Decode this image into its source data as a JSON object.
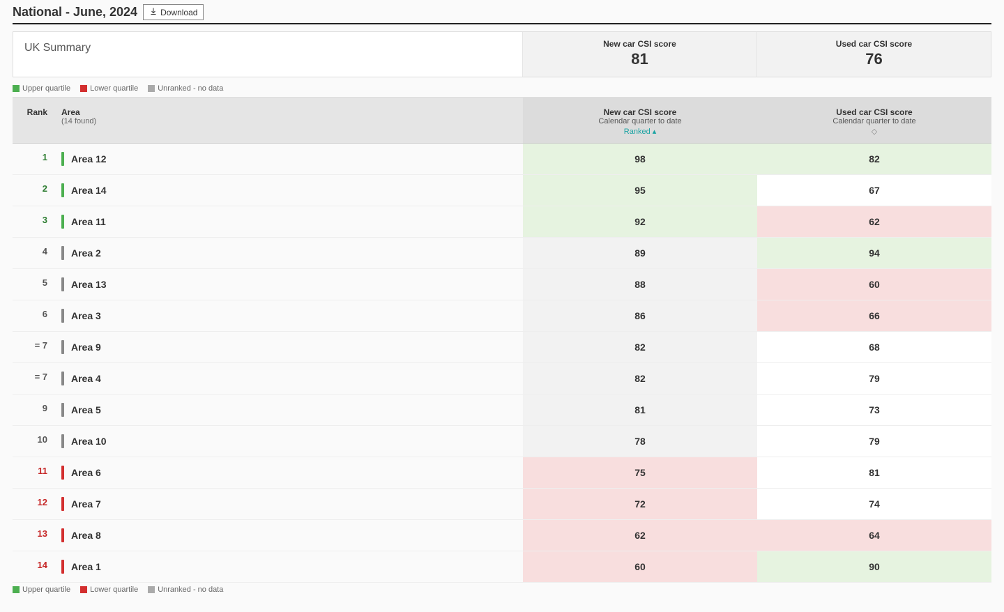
{
  "header": {
    "title": "National - June, 2024",
    "download_label": "Download"
  },
  "summary": {
    "label": "UK Summary",
    "new_title": "New car CSI score",
    "new_value": "81",
    "used_title": "Used car CSI score",
    "used_value": "76"
  },
  "legend": {
    "upper": "Upper quartile",
    "lower": "Lower quartile",
    "unranked": "Unranked - no data"
  },
  "table": {
    "columns": {
      "rank": "Rank",
      "area": "Area",
      "area_sub": "(14 found)",
      "new_title": "New car CSI score",
      "new_sub": "Calendar quarter to date",
      "new_sort": "Ranked",
      "used_title": "Used car CSI score",
      "used_sub": "Calendar quarter to date"
    },
    "rows": [
      {
        "rank": "1",
        "rank_q": "upper",
        "area": "Area 12",
        "new": "98",
        "new_q": "upper",
        "used": "82",
        "used_q": "upper"
      },
      {
        "rank": "2",
        "rank_q": "upper",
        "area": "Area 14",
        "new": "95",
        "new_q": "upper",
        "used": "67",
        "used_q": "white"
      },
      {
        "rank": "3",
        "rank_q": "upper",
        "area": "Area 11",
        "new": "92",
        "new_q": "upper",
        "used": "62",
        "used_q": "lower"
      },
      {
        "rank": "4",
        "rank_q": "mid",
        "area": "Area 2",
        "new": "89",
        "new_q": "mid",
        "used": "94",
        "used_q": "upper"
      },
      {
        "rank": "5",
        "rank_q": "mid",
        "area": "Area 13",
        "new": "88",
        "new_q": "mid",
        "used": "60",
        "used_q": "lower"
      },
      {
        "rank": "6",
        "rank_q": "mid",
        "area": "Area 3",
        "new": "86",
        "new_q": "mid",
        "used": "66",
        "used_q": "lower"
      },
      {
        "rank": "= 7",
        "rank_q": "mid",
        "area": "Area 9",
        "new": "82",
        "new_q": "mid",
        "used": "68",
        "used_q": "white"
      },
      {
        "rank": "= 7",
        "rank_q": "mid",
        "area": "Area 4",
        "new": "82",
        "new_q": "mid",
        "used": "79",
        "used_q": "white"
      },
      {
        "rank": "9",
        "rank_q": "mid",
        "area": "Area 5",
        "new": "81",
        "new_q": "mid",
        "used": "73",
        "used_q": "white"
      },
      {
        "rank": "10",
        "rank_q": "mid",
        "area": "Area 10",
        "new": "78",
        "new_q": "mid",
        "used": "79",
        "used_q": "white"
      },
      {
        "rank": "11",
        "rank_q": "lower",
        "area": "Area 6",
        "new": "75",
        "new_q": "lower",
        "used": "81",
        "used_q": "white"
      },
      {
        "rank": "12",
        "rank_q": "lower",
        "area": "Area 7",
        "new": "72",
        "new_q": "lower",
        "used": "74",
        "used_q": "white"
      },
      {
        "rank": "13",
        "rank_q": "lower",
        "area": "Area 8",
        "new": "62",
        "new_q": "lower",
        "used": "64",
        "used_q": "lower"
      },
      {
        "rank": "14",
        "rank_q": "lower",
        "area": "Area 1",
        "new": "60",
        "new_q": "lower",
        "used": "90",
        "used_q": "upper"
      }
    ]
  }
}
